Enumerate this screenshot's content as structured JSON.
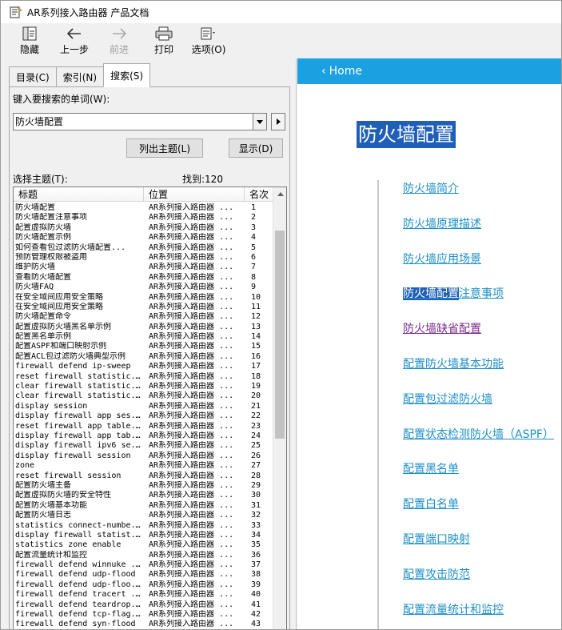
{
  "window": {
    "title": "AR系列接入路由器 产品文档"
  },
  "toolbar": {
    "hide": "隐藏",
    "back": "上一步",
    "forward": "前进",
    "print": "打印",
    "options": "选项(O)"
  },
  "tabs": [
    "目录(C)",
    "索引(N)",
    "搜索(S)"
  ],
  "search": {
    "keyword_label": "键入要搜索的单词(W):",
    "keyword_value": "防火墙配置",
    "list_topics_button": "列出主题(L)",
    "display_button": "显示(D)",
    "select_topic_label": "选择主题(T):",
    "found_label": "找到:120"
  },
  "results": {
    "columns": [
      "标题",
      "位置",
      "名次"
    ],
    "rows": [
      [
        "防火墙配置",
        "AR系列接入路由器 ...",
        "1"
      ],
      [
        "防火墙配置注意事项",
        "AR系列接入路由器 ...",
        "2"
      ],
      [
        "配置虚拟防火墙",
        "AR系列接入路由器 ...",
        "3"
      ],
      [
        "防火墙配置示例",
        "AR系列接入路由器 ...",
        "4"
      ],
      [
        "如何查看包过滤防火墙配置...",
        "AR系列接入路由器 ...",
        "5"
      ],
      [
        "预防管理权限被盗用",
        "AR系列接入路由器 ...",
        "6"
      ],
      [
        "维护防火墙",
        "AR系列接入路由器 ...",
        "7"
      ],
      [
        "查看防火墙配置",
        "AR系列接入路由器 ...",
        "8"
      ],
      [
        "防火墙FAQ",
        "AR系列接入路由器 ...",
        "9"
      ],
      [
        "在安全域间应用安全策略",
        "AR系列接入路由器 ...",
        "10"
      ],
      [
        "在安全域间应用安全策略",
        "AR系列接入路由器 ...",
        "11"
      ],
      [
        "防火墙配置命令",
        "AR系列接入路由器 ...",
        "12"
      ],
      [
        "配置虚拟防火墙黑名单示例",
        "AR系列接入路由器 ...",
        "13"
      ],
      [
        "配置黑名单示例",
        "AR系列接入路由器 ...",
        "14"
      ],
      [
        "配置ASPF和端口映射示例",
        "AR系列接入路由器 ...",
        "15"
      ],
      [
        "配置ACL包过滤防火墙典型示例",
        "AR系列接入路由器 ...",
        "16"
      ],
      [
        "firewall defend ip-sweep",
        "AR系列接入路由器 ...",
        "17"
      ],
      [
        "reset firewall statistic...",
        "AR系列接入路由器 ...",
        "18"
      ],
      [
        "clear firewall statistic...",
        "AR系列接入路由器 ...",
        "19"
      ],
      [
        "clear firewall statistic...",
        "AR系列接入路由器 ...",
        "20"
      ],
      [
        "display session",
        "AR系列接入路由器 ...",
        "21"
      ],
      [
        "display firewall app ses...",
        "AR系列接入路由器 ...",
        "22"
      ],
      [
        "reset firewall app table...",
        "AR系列接入路由器 ...",
        "23"
      ],
      [
        "display firewall app tab...",
        "AR系列接入路由器 ...",
        "24"
      ],
      [
        "display firewall ipv6 se...",
        "AR系列接入路由器 ...",
        "25"
      ],
      [
        "display firewall session",
        "AR系列接入路由器 ...",
        "26"
      ],
      [
        "zone",
        "AR系列接入路由器 ...",
        "27"
      ],
      [
        "reset firewall session",
        "AR系列接入路由器 ...",
        "28"
      ],
      [
        "配置防火墙主备",
        "AR系列接入路由器 ...",
        "29"
      ],
      [
        "配置虚拟防火墙的安全特性",
        "AR系列接入路由器 ...",
        "30"
      ],
      [
        "配置防火墙基本功能",
        "AR系列接入路由器 ...",
        "31"
      ],
      [
        "配置防火墙日志",
        "AR系列接入路由器 ...",
        "32"
      ],
      [
        "statistics connect-numbe...",
        "AR系列接入路由器 ...",
        "33"
      ],
      [
        "display firewall statist...",
        "AR系列接入路由器 ...",
        "34"
      ],
      [
        "statistics zone enable",
        "AR系列接入路由器 ...",
        "35"
      ],
      [
        "配置流量统计和监控",
        "AR系列接入路由器 ...",
        "36"
      ],
      [
        "firewall defend winnuke ...",
        "AR系列接入路由器 ...",
        "37"
      ],
      [
        "firewall defend udp-flood",
        "AR系列接入路由器 ...",
        "38"
      ],
      [
        "firewall defend udp-floo...",
        "AR系列接入路由器 ...",
        "39"
      ],
      [
        "firewall defend tracert ...",
        "AR系列接入路由器 ...",
        "40"
      ],
      [
        "firewall defend teardrop...",
        "AR系列接入路由器 ...",
        "41"
      ],
      [
        "firewall defend tcp-flag...",
        "AR系列接入路由器 ...",
        "42"
      ],
      [
        "firewall defend syn-flood",
        "AR系列接入路由器 ...",
        "43"
      ]
    ]
  },
  "content": {
    "home_label": "Home",
    "title": "防火墙配置",
    "toc": [
      {
        "label": "防火墙简介"
      },
      {
        "label": "防火墙原理描述"
      },
      {
        "label": "防火墙应用场景"
      },
      {
        "label_hl": "防火墙配置",
        "label_rest": "注意事项"
      },
      {
        "label": "防火墙缺省配置",
        "visited": true
      },
      {
        "label": "配置防火墙基本功能"
      },
      {
        "label": "配置包过滤防火墙"
      },
      {
        "label": "配置状态检测防火墙（ASPF）"
      },
      {
        "label": "配置黑名单"
      },
      {
        "label": "配置白名单"
      },
      {
        "label": "配置端口映射"
      },
      {
        "label": "配置攻击防范"
      },
      {
        "label": "配置流量统计和监控"
      }
    ]
  },
  "colors": {
    "accent": "#1ba1e2",
    "link": "#1e90c8",
    "highlight": "#1f5fb8",
    "visited": "#7b2b8f"
  }
}
